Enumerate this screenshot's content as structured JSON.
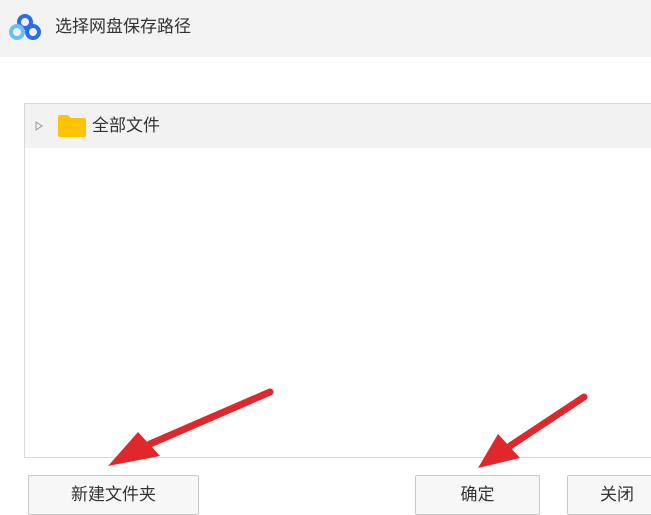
{
  "dialog": {
    "title": "选择网盘保存路径",
    "logo_icon": "baidu-netdisk-cloud-icon"
  },
  "tree": {
    "items": [
      {
        "label": "全部文件",
        "icon": "folder-icon",
        "expand_icon": "triangle-right-icon"
      }
    ]
  },
  "buttons": {
    "new_folder": "新建文件夹",
    "confirm": "确定",
    "close": "关闭"
  },
  "annotations": {
    "arrow_color": "#e0272b"
  },
  "colors": {
    "folder": "#ffc400",
    "logo_blue": "#2b6de5",
    "logo_light": "#68c0f8"
  }
}
